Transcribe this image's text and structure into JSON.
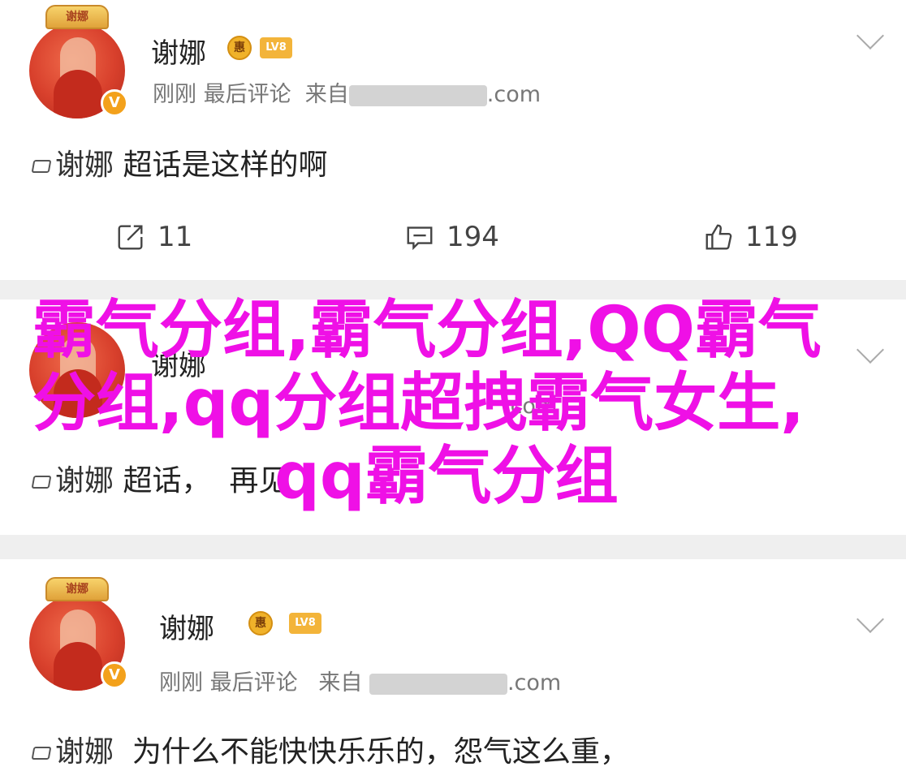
{
  "posts": [
    {
      "user": "谢娜",
      "badge_round": "惠",
      "badge_lv": "LV8",
      "crown_text": "谢娜",
      "verified": "V",
      "meta": {
        "time": "刚刚",
        "action": "最后评论",
        "from": "来自",
        "source_suffix": ".com"
      },
      "content": {
        "tag": "谢娜",
        "text": "超话是这样的啊"
      },
      "actions": {
        "repost": "11",
        "comment": "194",
        "like": "119"
      }
    },
    {
      "user": "谢娜",
      "meta": {
        "time": "",
        "action": "",
        "from": "",
        "source_suffix": ".com"
      },
      "content": {
        "tag": "谢娜",
        "text": "超话，",
        "text2": "再见"
      }
    },
    {
      "user": "谢娜",
      "badge_round": "惠",
      "badge_lv": "LV8",
      "crown_text": "谢娜",
      "verified": "V",
      "meta": {
        "time": "刚刚",
        "action": "最后评论",
        "from": "来自",
        "source_suffix": ".com"
      },
      "content": {
        "tag": "谢娜",
        "text": "为什么不能快快乐乐的，怨气这么重，"
      }
    }
  ],
  "overlay": {
    "line1": "霸气分组,霸气分组,QQ霸气",
    "line2": "分组,qq分组超拽霸气女生,",
    "line3": "qq霸气分组"
  },
  "colors": {
    "overlay": "#ef10e6",
    "separator": "#efefef",
    "text": "#222222",
    "meta": "#777777"
  }
}
